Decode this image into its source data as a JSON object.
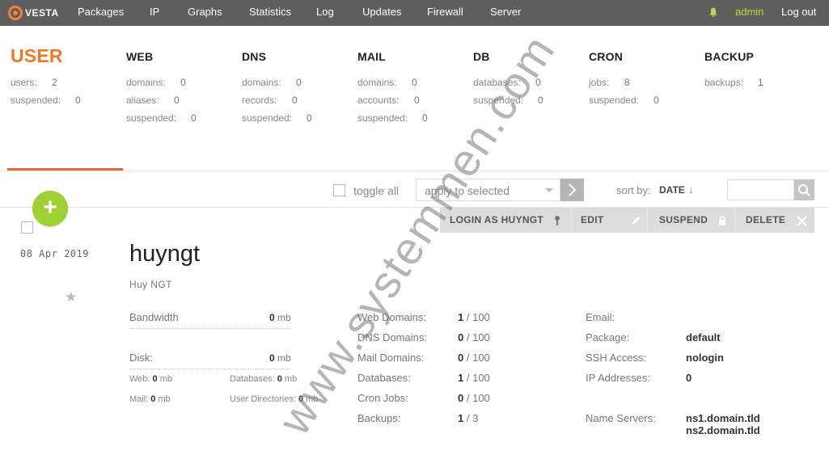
{
  "topbar": {
    "logo_text": "VESTA",
    "nav": [
      "Packages",
      "IP",
      "Graphs",
      "Statistics",
      "Log",
      "Updates",
      "Firewall",
      "Server"
    ],
    "user": "admin",
    "logout": "Log out"
  },
  "stats": {
    "user": {
      "title": "USER",
      "rows": [
        {
          "label": "users:",
          "value": "2"
        },
        {
          "label": "suspended:",
          "value": "0"
        }
      ]
    },
    "web": {
      "title": "WEB",
      "rows": [
        {
          "label": "domains:",
          "value": "0"
        },
        {
          "label": "aliases:",
          "value": "0"
        },
        {
          "label": "suspended:",
          "value": "0"
        }
      ]
    },
    "dns": {
      "title": "DNS",
      "rows": [
        {
          "label": "domains:",
          "value": "0"
        },
        {
          "label": "records:",
          "value": "0"
        },
        {
          "label": "suspended:",
          "value": "0"
        }
      ]
    },
    "mail": {
      "title": "MAIL",
      "rows": [
        {
          "label": "domains:",
          "value": "0"
        },
        {
          "label": "accounts:",
          "value": "0"
        },
        {
          "label": "suspended:",
          "value": "0"
        }
      ]
    },
    "db": {
      "title": "DB",
      "rows": [
        {
          "label": "databases:",
          "value": "0"
        },
        {
          "label": "suspended:",
          "value": "0"
        }
      ]
    },
    "cron": {
      "title": "CRON",
      "rows": [
        {
          "label": "jobs:",
          "value": "8"
        },
        {
          "label": "suspended:",
          "value": "0"
        }
      ]
    },
    "backup": {
      "title": "BACKUP",
      "rows": [
        {
          "label": "backups:",
          "value": "1"
        }
      ]
    }
  },
  "toolbar": {
    "toggle_all": "toggle all",
    "apply_placeholder": "apply to selected",
    "sort_label": "sort by:",
    "sort_value": "DATE",
    "sort_arrow": "↓"
  },
  "actions": {
    "login_as": "LOGIN AS HUYNGT",
    "edit": "EDIT",
    "suspend": "SUSPEND",
    "delete": "DELETE"
  },
  "user_card": {
    "date": "08 Apr 2019",
    "username": "huyngt",
    "fullname": "Huy NGT",
    "bandwidth_label": "Bandwidth",
    "bandwidth_value": "0",
    "disk_label": "Disk:",
    "disk_value": "0",
    "unit": "mb",
    "disk_breakdown": [
      {
        "label": "Web:",
        "value": "0"
      },
      {
        "label": "Databases:",
        "value": "0"
      },
      {
        "label": "Mail:",
        "value": "0"
      },
      {
        "label": "User Directories:",
        "value": "0"
      }
    ],
    "limits": [
      {
        "label": "Web Domains:",
        "used": "1",
        "max": "/ 100"
      },
      {
        "label": "DNS Domains:",
        "used": "0",
        "max": "/ 100"
      },
      {
        "label": "Mail Domains:",
        "used": "0",
        "max": "/ 100"
      },
      {
        "label": "Databases:",
        "used": "1",
        "max": "/ 100"
      },
      {
        "label": "Cron Jobs:",
        "used": "0",
        "max": "/ 100"
      },
      {
        "label": "Backups:",
        "used": "1",
        "max": "/ 3"
      }
    ],
    "info": {
      "email_label": "Email:",
      "email_value": "",
      "package_label": "Package:",
      "package_value": "default",
      "ssh_label": "SSH Access:",
      "ssh_value": "nologin",
      "ip_label": "IP Addresses:",
      "ip_value": "0",
      "ns_label": "Name Servers:",
      "ns1": "ns1.domain.tld",
      "ns2": "ns2.domain.tld"
    }
  },
  "watermark": "www.systemmen.com",
  "colors": {
    "accent": "#f07827",
    "add_button": "#9fd033",
    "topbar": "#5e5e5e",
    "admin": "#b8d94c"
  }
}
